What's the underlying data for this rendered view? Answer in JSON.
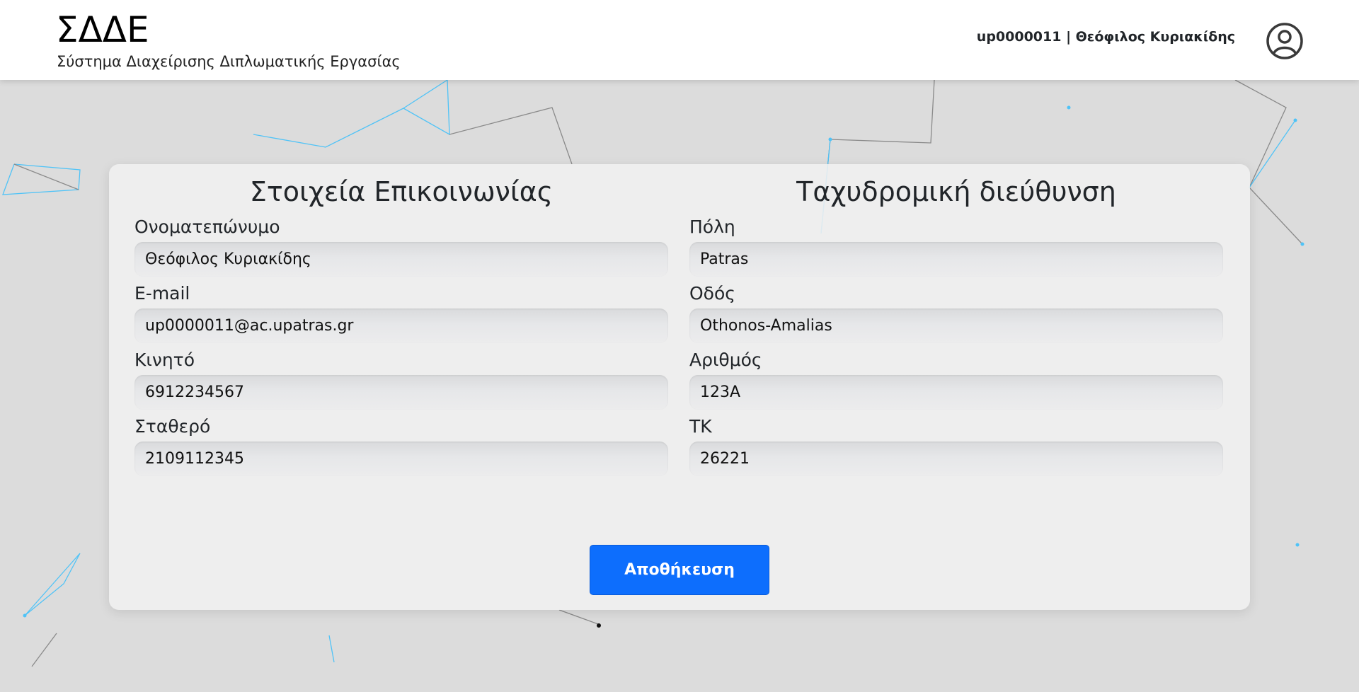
{
  "header": {
    "title": "ΣΔΔΕ",
    "subtitle": "Σύστημα Διαχείρισης Διπλωματικής Εργασίας",
    "user_info": "up0000011 | Θεόφιλος Κυριακίδης",
    "avatar_icon": "user-circle-icon"
  },
  "contact": {
    "heading": "Στοιχεία Επικοινωνίας",
    "fields": [
      {
        "label": "Ονοματεπώνυμο",
        "value": "Θεόφιλος Κυριακίδης"
      },
      {
        "label": "E-mail",
        "value": "up0000011@ac.upatras.gr"
      },
      {
        "label": "Κινητό",
        "value": "6912234567"
      },
      {
        "label": "Σταθερό",
        "value": "2109112345"
      }
    ]
  },
  "address": {
    "heading": "Ταχυδρομική διεύθυνση",
    "fields": [
      {
        "label": "Πόλη",
        "value": "Patras"
      },
      {
        "label": "Οδός",
        "value": "Othonos-Amalias"
      },
      {
        "label": "Αριθμός",
        "value": "123A"
      },
      {
        "label": "ΤΚ",
        "value": "26221"
      }
    ]
  },
  "actions": {
    "save_label": "Αποθήκευση"
  },
  "colors": {
    "primary": "#0d6efd",
    "background": "#dcdcdc",
    "network_line_blue": "#4fc3f7",
    "network_line_gray": "#8a8a8a"
  }
}
